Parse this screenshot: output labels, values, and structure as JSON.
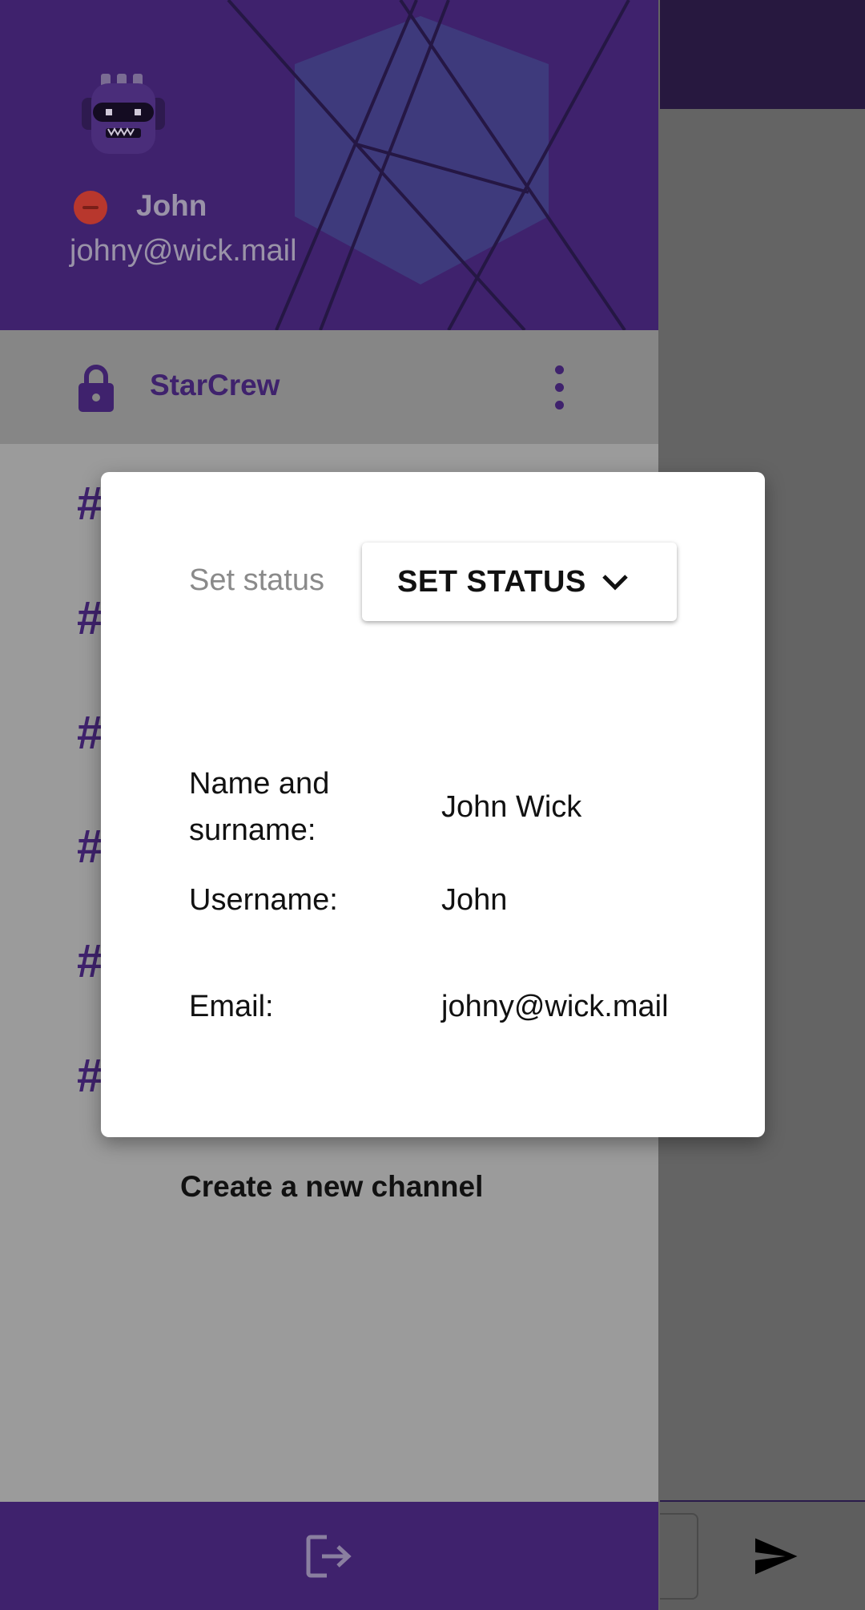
{
  "drawer": {
    "user": {
      "name": "John",
      "email": "johny@wick.mail",
      "status_color": "#b8372d"
    },
    "team": {
      "name": "StarCrew"
    },
    "channels": [
      "#",
      "#",
      "#",
      "#",
      "#",
      "#"
    ],
    "create_channel_label": "Create a new channel",
    "footer": {
      "icon": "logout-icon"
    }
  },
  "dialog": {
    "status_label": "Set status",
    "status_button_label": "SET STATUS",
    "fields": [
      {
        "label": "Name and surname:",
        "value": "John Wick"
      },
      {
        "label": "Username:",
        "value": "John"
      },
      {
        "label": "Email:",
        "value": "johny@wick.mail"
      }
    ]
  },
  "colors": {
    "brand_purple": "#3f226d",
    "app_bar_dark": "#27183f",
    "overlay_grey": "#9b9b9b"
  }
}
